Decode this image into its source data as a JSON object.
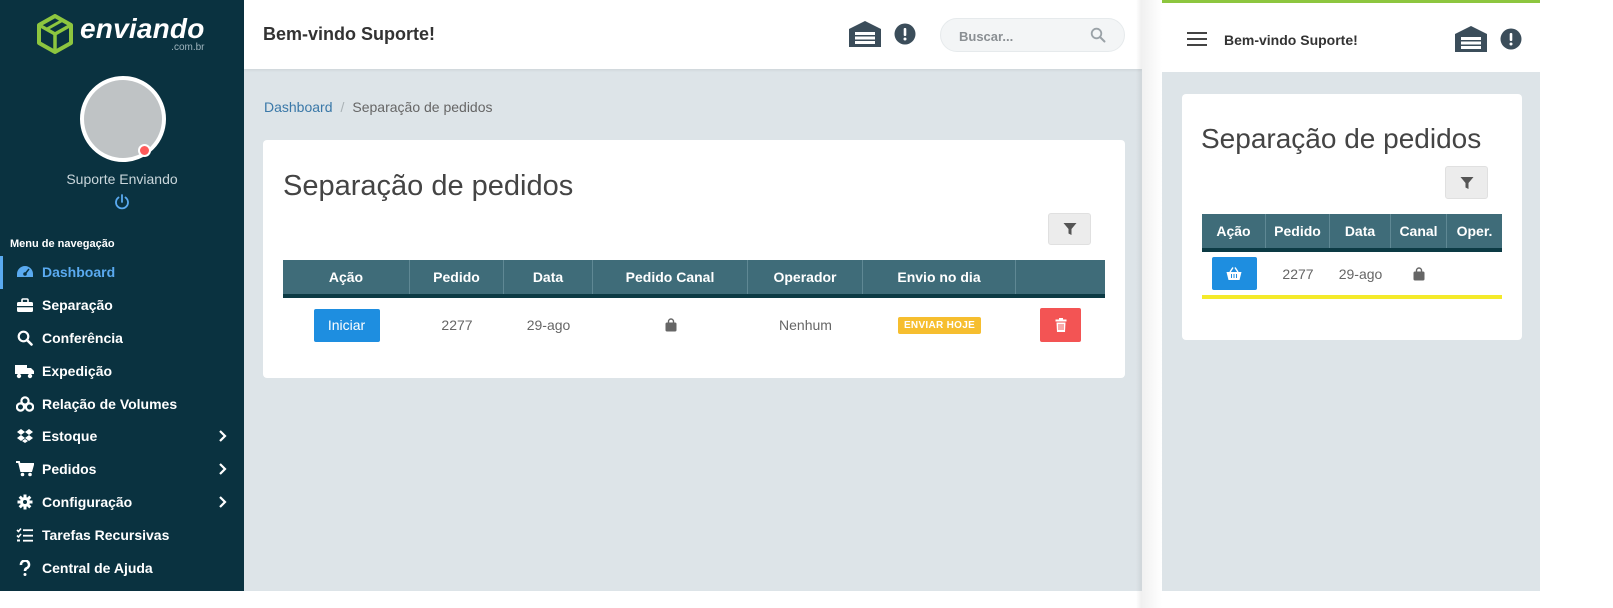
{
  "brand": {
    "name": "enviando",
    "subdomain": ".com.br"
  },
  "user": {
    "name": "Suporte Enviando"
  },
  "nav": {
    "title": "Menu de navegação",
    "items": [
      {
        "label": "Dashboard",
        "icon": "dashboard-icon",
        "active": true,
        "has_children": false
      },
      {
        "label": "Separação",
        "icon": "briefcase-icon",
        "active": false,
        "has_children": false
      },
      {
        "label": "Conferência",
        "icon": "search-icon",
        "active": false,
        "has_children": false
      },
      {
        "label": "Expedição",
        "icon": "truck-icon",
        "active": false,
        "has_children": false
      },
      {
        "label": "Relação de Volumes",
        "icon": "boxes-icon",
        "active": false,
        "has_children": false
      },
      {
        "label": "Estoque",
        "icon": "dropbox-icon",
        "active": false,
        "has_children": true
      },
      {
        "label": "Pedidos",
        "icon": "cart-icon",
        "active": false,
        "has_children": true
      },
      {
        "label": "Configuração",
        "icon": "cog-icon",
        "active": false,
        "has_children": true
      },
      {
        "label": "Tarefas Recursivas",
        "icon": "tasks-icon",
        "active": false,
        "has_children": false
      },
      {
        "label": "Central de Ajuda",
        "icon": "question-icon",
        "active": false,
        "has_children": false
      }
    ]
  },
  "header": {
    "welcome": "Bem-vindo Suporte!",
    "search_placeholder": "Buscar..."
  },
  "breadcrumb": {
    "home": "Dashboard",
    "current": "Separação de pedidos"
  },
  "page": {
    "title": "Separação de pedidos",
    "table": {
      "columns": [
        "Ação",
        "Pedido",
        "Data",
        "Pedido Canal",
        "Operador",
        "Envio no dia",
        ""
      ],
      "rows": [
        {
          "action_label": "Iniciar",
          "pedido": "2277",
          "data": "29-ago",
          "canal_icon": "shopping-bag-icon",
          "operador": "Nenhum",
          "envio": "ENVIAR HOJE"
        }
      ]
    }
  },
  "mobile": {
    "welcome": "Bem-vindo Suporte!",
    "title": "Separação de pedidos",
    "columns": [
      "Ação",
      "Pedido",
      "Data",
      "Canal",
      "Oper."
    ],
    "rows": [
      {
        "action_icon": "basket-icon",
        "pedido": "2277",
        "data": "29-ago",
        "canal_icon": "shopping-bag-icon",
        "operador": ""
      }
    ]
  },
  "colors": {
    "sidebar_bg": "#0a3240",
    "accent": "#8dc63f",
    "active_link": "#5aaaf0",
    "table_header": "#3f6c79",
    "primary_button": "#1e8ee0",
    "danger_button": "#f35454",
    "badge_warning": "#f6be2f"
  }
}
